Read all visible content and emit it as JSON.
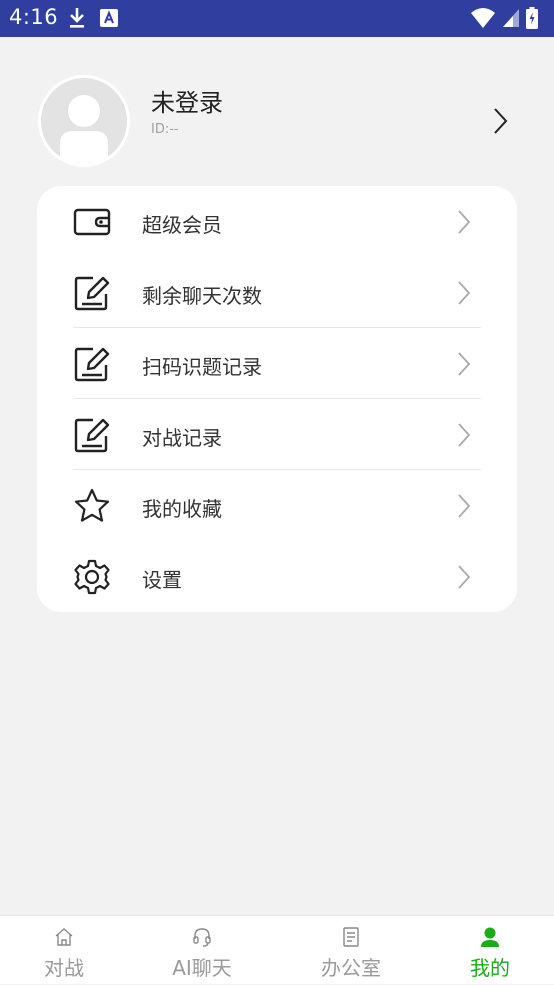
{
  "status_bar": {
    "time": "4:16",
    "left_icons": [
      "download-icon",
      "a-badge-icon"
    ],
    "right_icons": [
      "wifi-icon",
      "cellular-signal-icon",
      "battery-icon"
    ],
    "background": "#303f9f"
  },
  "profile": {
    "name": "未登录",
    "id_label": "ID:--"
  },
  "menu": {
    "items": [
      {
        "label": "超级会员",
        "icon": "wallet-icon"
      },
      {
        "label": "剩余聊天次数",
        "icon": "edit-note-icon"
      },
      {
        "label": "扫码识题记录",
        "icon": "edit-note-icon"
      },
      {
        "label": "对战记录",
        "icon": "edit-note-icon"
      },
      {
        "label": "我的收藏",
        "icon": "star-icon"
      },
      {
        "label": "设置",
        "icon": "gear-icon"
      }
    ]
  },
  "tab_bar": {
    "tabs": [
      {
        "label": "对战",
        "icon": "home-icon",
        "active": false
      },
      {
        "label": "AI聊天",
        "icon": "headset-icon",
        "active": false
      },
      {
        "label": "办公室",
        "icon": "document-icon",
        "active": false
      },
      {
        "label": "我的",
        "icon": "person-icon",
        "active": true
      }
    ],
    "active_color": "#1aad19",
    "inactive_color": "#9a9a9a"
  }
}
